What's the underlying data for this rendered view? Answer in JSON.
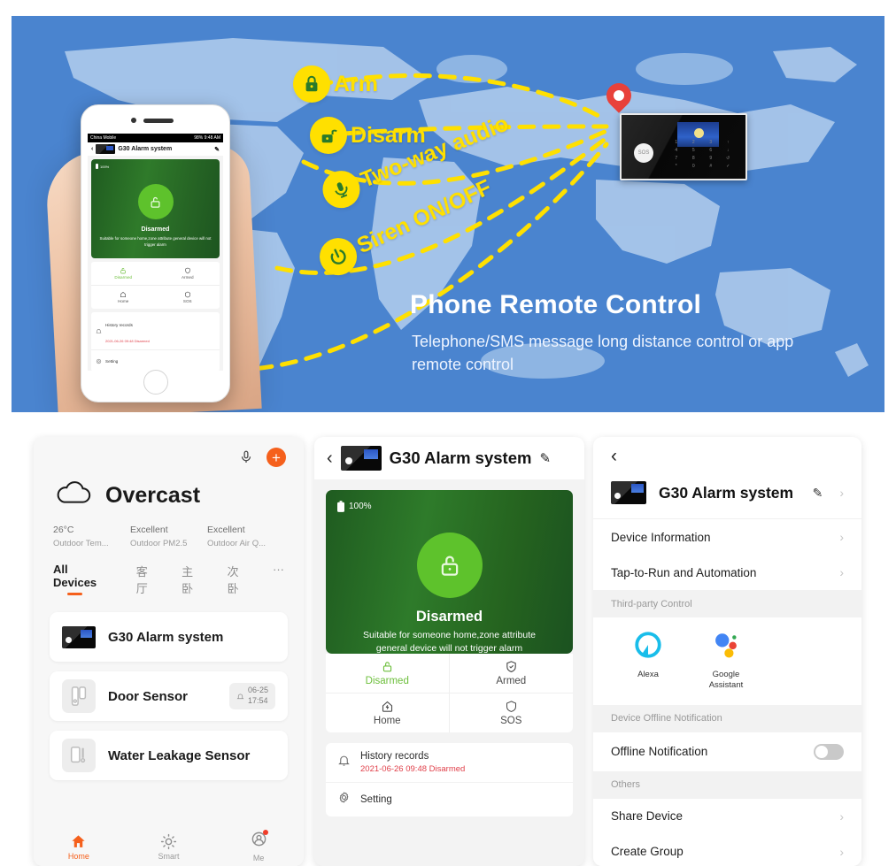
{
  "banner": {
    "title": "Phone Remote Control",
    "subtitle": "Telephone/SMS message long distance control or app remote control",
    "features": [
      {
        "label": "Arm",
        "icon": "lock-closed-icon"
      },
      {
        "label": "Disarm",
        "icon": "lock-open-icon"
      },
      {
        "label": "Two-way audio",
        "icon": "microphone-icon"
      },
      {
        "label": "Siren ON/OFF",
        "icon": "power-icon"
      }
    ],
    "phone_mock": {
      "status_bar": {
        "carrier": "China Mobile",
        "battery": "98%",
        "time": "9:48 AM"
      },
      "header_title": "G30 Alarm system",
      "battery": "100%",
      "state": "Disarmed",
      "state_desc": "Suitable for someone home,zone attribute general device will not trigger alarm",
      "modes": [
        "Disarmed",
        "Armed",
        "Home",
        "SOS"
      ],
      "history_title": "History records",
      "history_value": "2021-06-26 09:48 Disarmed",
      "setting_label": "Setting"
    },
    "alarm_panel": {
      "sos_label": "SOS",
      "keys": [
        "1",
        "2",
        "3",
        "↑",
        "4",
        "5",
        "6",
        "↓",
        "7",
        "8",
        "9",
        "↺",
        "*",
        "0",
        "#",
        "✓"
      ]
    }
  },
  "left_panel": {
    "mic_icon": "microphone-icon",
    "add_label": "+",
    "weather": {
      "condition": "Overcast",
      "icon": "cloud-icon",
      "stats": [
        {
          "value": "26°C",
          "label": "Outdoor Tem..."
        },
        {
          "value": "Excellent",
          "label": "Outdoor PM2.5"
        },
        {
          "value": "Excellent",
          "label": "Outdoor Air Q..."
        }
      ]
    },
    "tabs": [
      {
        "label": "All Devices",
        "selected": true
      },
      {
        "label": "客厅",
        "selected": false
      },
      {
        "label": "主卧",
        "selected": false
      },
      {
        "label": "次卧",
        "selected": false
      },
      {
        "label": "···",
        "selected": false
      }
    ],
    "devices": [
      {
        "name": "G30 Alarm system",
        "icon": "alarm-panel-thumb",
        "time_date": "",
        "time_clock": ""
      },
      {
        "name": "Door Sensor",
        "icon": "door-sensor-icon",
        "time_date": "06-25",
        "time_clock": "17:54"
      },
      {
        "name": "Water Leakage Sensor",
        "icon": "water-sensor-icon",
        "time_date": "",
        "time_clock": ""
      }
    ],
    "bottom_nav": [
      {
        "label": "Home",
        "icon": "home-icon",
        "active": true
      },
      {
        "label": "Smart",
        "icon": "sun-icon",
        "active": false
      },
      {
        "label": "Me",
        "icon": "profile-icon",
        "active": false
      }
    ]
  },
  "middle_panel": {
    "back_icon": "chevron-left-icon",
    "title": "G30 Alarm system",
    "edit_icon": "pencil-icon",
    "battery": "100%",
    "state": "Disarmed",
    "state_desc_line1": "Suitable for someone home,zone attribute",
    "state_desc_line2": "general device will not trigger alarm",
    "modes": [
      {
        "label": "Disarmed",
        "icon": "lock-open-icon",
        "active": true
      },
      {
        "label": "Armed",
        "icon": "shield-check-icon",
        "active": false
      },
      {
        "label": "Home",
        "icon": "home-bolt-icon",
        "active": false
      },
      {
        "label": "SOS",
        "icon": "sos-icon",
        "active": false
      }
    ],
    "history": {
      "title": "History records",
      "value": "2021-06-26 09:48 Disarmed",
      "icon": "bell-icon"
    },
    "setting": {
      "label": "Setting",
      "icon": "gear-icon"
    }
  },
  "right_panel": {
    "back_icon": "chevron-left-icon",
    "device_name": "G30 Alarm system",
    "edit_icon": "pencil-icon",
    "rows_top": [
      {
        "label": "Device Information"
      },
      {
        "label": "Tap-to-Run and Automation"
      }
    ],
    "section_third_party": "Third-party Control",
    "assistants": [
      {
        "name": "Alexa",
        "icon": "alexa-icon"
      },
      {
        "name": "Google Assistant",
        "icon": "google-assistant-icon"
      }
    ],
    "section_offline": "Device Offline Notification",
    "offline_row": {
      "label": "Offline Notification",
      "toggle_on": false
    },
    "section_others": "Others",
    "rows_others": [
      {
        "label": "Share Device"
      },
      {
        "label": "Create Group"
      }
    ]
  },
  "colors": {
    "banner_bg": "#4a84cf",
    "accent_yellow": "#ffe000",
    "accent_orange": "#f5601c",
    "green_active": "#5ec22c",
    "red_text": "#e0404a"
  }
}
